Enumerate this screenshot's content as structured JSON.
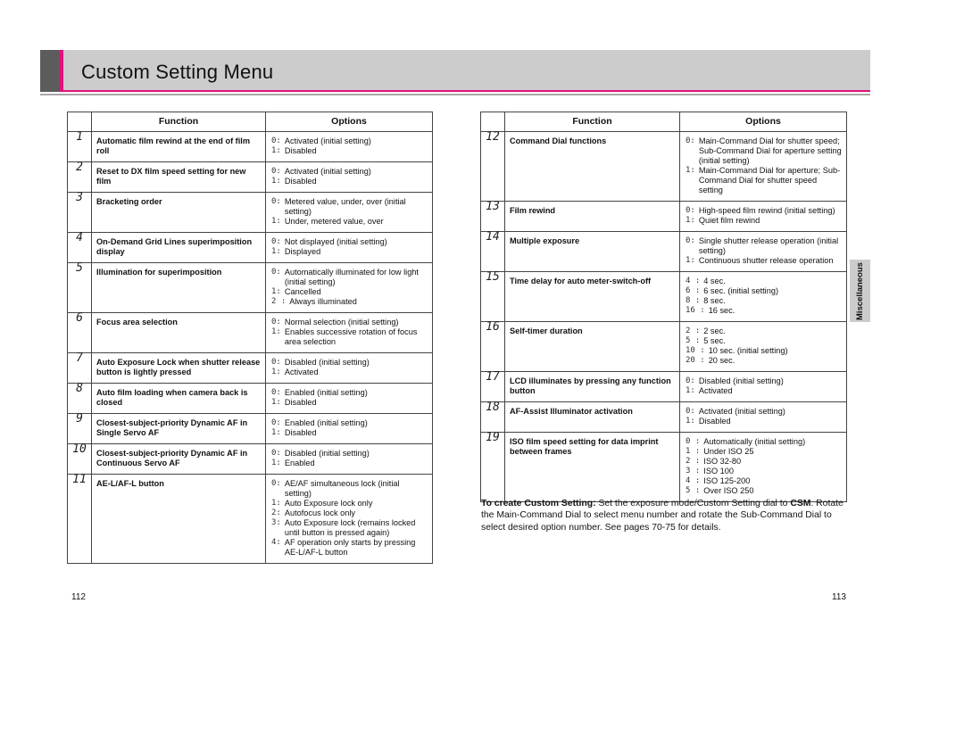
{
  "header": {
    "title": "Custom Setting Menu"
  },
  "table_headers": {
    "function": "Function",
    "options": "Options"
  },
  "left_rows": [
    {
      "num": "1",
      "function": "Automatic film rewind at the end of film roll",
      "options": [
        {
          "k": "0:",
          "v": "Activated (initial setting)"
        },
        {
          "k": "1:",
          "v": "Disabled"
        }
      ]
    },
    {
      "num": "2",
      "function": "Reset to DX film speed setting for new film",
      "options": [
        {
          "k": "0:",
          "v": "Activated (initial setting)"
        },
        {
          "k": "1:",
          "v": "Disabled"
        }
      ]
    },
    {
      "num": "3",
      "function": "Bracketing order",
      "options": [
        {
          "k": "0:",
          "v": "Metered value, under, over (initial setting)"
        },
        {
          "k": "1:",
          "v": "Under, metered value, over"
        }
      ]
    },
    {
      "num": "4",
      "function": "On-Demand Grid Lines superimposition display",
      "options": [
        {
          "k": "0:",
          "v": "Not displayed (initial setting)"
        },
        {
          "k": "1:",
          "v": "Displayed"
        }
      ]
    },
    {
      "num": "5",
      "function": "Illumination for superimposition",
      "options": [
        {
          "k": "0:",
          "v": "Automatically illuminated for low light (initial setting)"
        },
        {
          "k": "1:",
          "v": "Cancelled"
        },
        {
          "k": "2 :",
          "v": "Always illuminated"
        }
      ]
    },
    {
      "num": "6",
      "function": "Focus area selection",
      "options": [
        {
          "k": "0:",
          "v": "Normal selection (initial setting)"
        },
        {
          "k": "1:",
          "v": "Enables successive rotation of focus area selection"
        }
      ]
    },
    {
      "num": "7",
      "function": "Auto Exposure Lock when shutter release button is lightly pressed",
      "options": [
        {
          "k": "0:",
          "v": "Disabled (initial setting)"
        },
        {
          "k": "1:",
          "v": "Activated"
        }
      ]
    },
    {
      "num": "8",
      "function": "Auto film loading when camera back is closed",
      "options": [
        {
          "k": "0:",
          "v": "Enabled (initial setting)"
        },
        {
          "k": "1:",
          "v": "Disabled"
        }
      ]
    },
    {
      "num": "9",
      "function": "Closest-subject-priority Dynamic AF in Single Servo AF",
      "options": [
        {
          "k": "0:",
          "v": "Enabled (initial setting)"
        },
        {
          "k": "1:",
          "v": "Disabled"
        }
      ]
    },
    {
      "num": "10",
      "function": "Closest-subject-priority Dynamic AF in Continuous Servo AF",
      "options": [
        {
          "k": "0:",
          "v": "Disabled (initial setting)"
        },
        {
          "k": "1:",
          "v": "Enabled"
        }
      ]
    },
    {
      "num": "11",
      "function": "AE-L/AF-L button",
      "options": [
        {
          "k": "0:",
          "v": "AE/AF simultaneous lock (initial setting)"
        },
        {
          "k": "1:",
          "v": "Auto Exposure lock only"
        },
        {
          "k": "2:",
          "v": "Autofocus lock only"
        },
        {
          "k": "3:",
          "v": "Auto Exposure lock (remains locked until button is pressed again)"
        },
        {
          "k": "4:",
          "v": "AF operation only starts by pressing AE-L/AF-L button"
        }
      ]
    }
  ],
  "right_rows": [
    {
      "num": "12",
      "function": "Command Dial functions",
      "options": [
        {
          "k": "0:",
          "v": "Main-Command Dial for shutter speed; Sub-Command Dial for aperture setting (initial setting)"
        },
        {
          "k": "1:",
          "v": "Main-Command Dial for aperture; Sub-Command Dial for shutter speed setting"
        }
      ]
    },
    {
      "num": "13",
      "function": "Film rewind",
      "options": [
        {
          "k": "0:",
          "v": "High-speed film rewind (initial setting)"
        },
        {
          "k": "1:",
          "v": "Quiet film rewind"
        }
      ]
    },
    {
      "num": "14",
      "function": "Multiple exposure",
      "options": [
        {
          "k": "0:",
          "v": "Single shutter release operation (initial setting)"
        },
        {
          "k": "1:",
          "v": "Continuous shutter release operation"
        }
      ]
    },
    {
      "num": "15",
      "function": "Time delay for auto meter-switch-off",
      "options": [
        {
          "k": "4 :",
          "v": "4 sec."
        },
        {
          "k": "6 :",
          "v": "6 sec. (initial setting)"
        },
        {
          "k": "8 :",
          "v": "8 sec."
        },
        {
          "k": "16 :",
          "v": "16 sec."
        }
      ]
    },
    {
      "num": "16",
      "function": "Self-timer duration",
      "options": [
        {
          "k": "2 :",
          "v": "2 sec."
        },
        {
          "k": "5 :",
          "v": "5 sec."
        },
        {
          "k": "10 :",
          "v": "10 sec. (initial setting)"
        },
        {
          "k": "20 :",
          "v": "20 sec."
        }
      ]
    },
    {
      "num": "17",
      "function": "LCD illuminates by pressing any function button",
      "options": [
        {
          "k": "0:",
          "v": "Disabled (initial setting)"
        },
        {
          "k": "1:",
          "v": "Activated"
        }
      ]
    },
    {
      "num": "18",
      "function": "AF-Assist Illuminator activation",
      "options": [
        {
          "k": "0:",
          "v": "Activated (initial setting)"
        },
        {
          "k": "1:",
          "v": "Disabled"
        }
      ]
    },
    {
      "num": "19",
      "function": "ISO film speed setting for data imprint between frames",
      "options": [
        {
          "k": "0 :",
          "v": "Automatically (initial setting)"
        },
        {
          "k": "1 :",
          "v": "Under ISO 25"
        },
        {
          "k": "2 :",
          "v": "ISO 32-80"
        },
        {
          "k": "3 :",
          "v": "ISO 100"
        },
        {
          "k": "4 :",
          "v": "ISO 125-200"
        },
        {
          "k": "5 :",
          "v": "Over ISO 250"
        }
      ]
    }
  ],
  "side_tab": {
    "label": "Miscellaneous"
  },
  "instructions": {
    "lead": "To create Custom Setting:",
    "text1": " Set the exposure mode/Custom Setting dial to ",
    "bold_term": "CSM",
    "text2": ". Rotate the Main-Command Dial to select menu number and rotate the Sub-Command Dial to select desired option number. See pages 70-75 for details."
  },
  "page_numbers": {
    "left": "112",
    "right": "113"
  }
}
